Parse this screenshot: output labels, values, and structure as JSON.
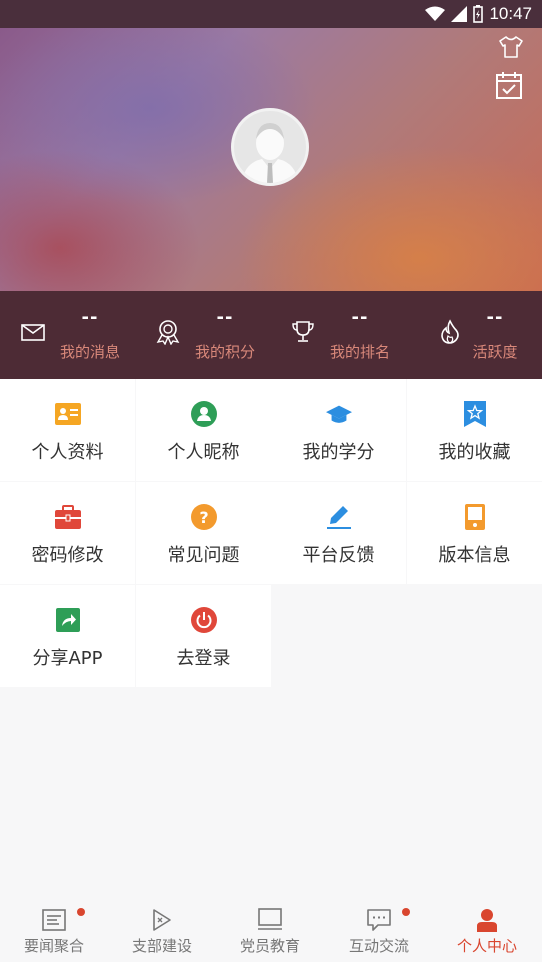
{
  "status_bar": {
    "time": "10:47"
  },
  "colors": {
    "accent": "#d9462f",
    "header_dark": "#4d2b35",
    "stat_label": "#d9887a"
  },
  "header": {
    "icons": [
      "shirt-icon",
      "calendar-check-icon"
    ],
    "avatar": "default-avatar"
  },
  "stats": [
    {
      "icon": "mail-icon",
      "value": "--",
      "label": "我的消息"
    },
    {
      "icon": "medal-icon",
      "value": "--",
      "label": "我的积分"
    },
    {
      "icon": "trophy-icon",
      "value": "--",
      "label": "我的排名"
    },
    {
      "icon": "flame-icon",
      "value": "--",
      "label": "活跃度"
    }
  ],
  "menu": [
    {
      "icon": "id-card-icon",
      "label": "个人资料",
      "color": "#f5a623"
    },
    {
      "icon": "user-circle-icon",
      "label": "个人昵称",
      "color": "#2e9e57"
    },
    {
      "icon": "graduation-cap-icon",
      "label": "我的学分",
      "color": "#2c8ee0"
    },
    {
      "icon": "bookmark-star-icon",
      "label": "我的收藏",
      "color": "#2c8ee0"
    },
    {
      "icon": "briefcase-icon",
      "label": "密码修改",
      "color": "#e0473a"
    },
    {
      "icon": "question-icon",
      "label": "常见问题",
      "color": "#f39a2d"
    },
    {
      "icon": "pen-icon",
      "label": "平台反馈",
      "color": "#2c8ee0"
    },
    {
      "icon": "device-icon",
      "label": "版本信息",
      "color": "#f39a2d"
    },
    {
      "icon": "share-icon",
      "label": "分享APP",
      "color": "#2e9e57"
    },
    {
      "icon": "power-icon",
      "label": "去登录",
      "color": "#e0473a"
    }
  ],
  "tabs": [
    {
      "icon": "news-icon",
      "label": "要闻聚合",
      "active": false,
      "badge": true
    },
    {
      "icon": "play-flag-icon",
      "label": "支部建设",
      "active": false,
      "badge": false
    },
    {
      "icon": "monitor-icon",
      "label": "党员教育",
      "active": false,
      "badge": false
    },
    {
      "icon": "chat-icon",
      "label": "互动交流",
      "active": false,
      "badge": true
    },
    {
      "icon": "person-icon",
      "label": "个人中心",
      "active": true,
      "badge": false
    }
  ]
}
